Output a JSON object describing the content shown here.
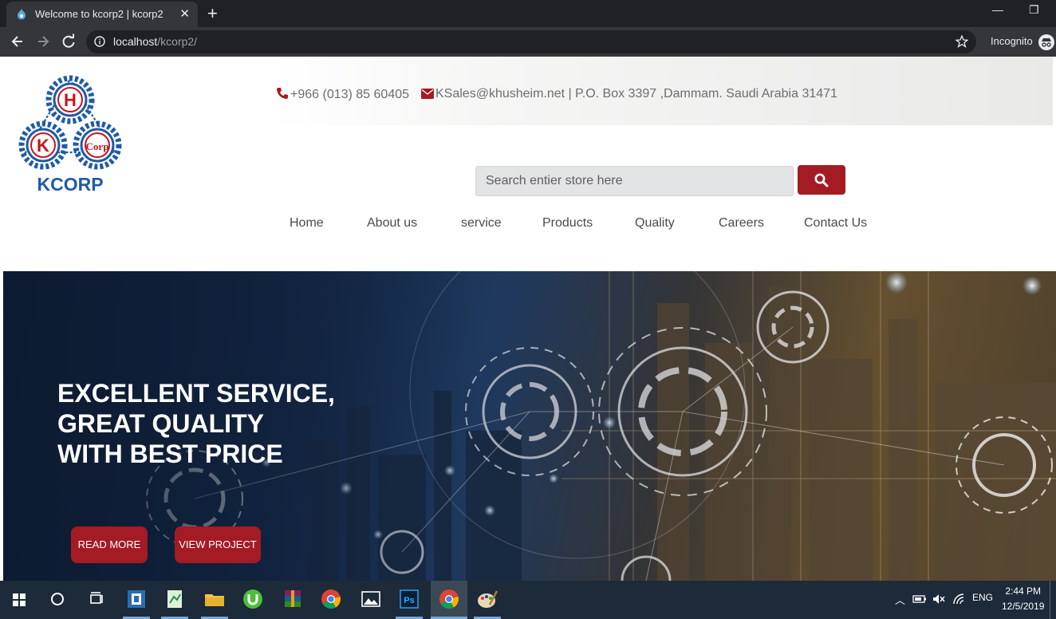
{
  "browser": {
    "tab_title": "Welcome to kcorp2 | kcorp2",
    "url_host": "localhost",
    "url_path": "/kcorp2/",
    "incognito_label": "Incognito"
  },
  "contact": {
    "phone": "+966 (013) 85 60405",
    "email_address": "KSales@khusheim.net | P.O. Box 3397 ,Dammam. Saudi Arabia 31471"
  },
  "logo": {
    "text": "KCORP",
    "letters": [
      "H",
      "K",
      "Corp"
    ]
  },
  "search": {
    "placeholder": "Search entier store here"
  },
  "nav": {
    "items": [
      "Home",
      "About us",
      "service",
      "Products",
      "Quality",
      "Careers",
      "Contact Us"
    ]
  },
  "hero": {
    "line1": "EXCELLENT SERVICE,",
    "line2": "GREAT QUALITY",
    "line3": "WITH BEST PRICE",
    "btn_read_more": "READ MORE",
    "btn_view_project": "VIEW PROJECT"
  },
  "taskbar": {
    "lang": "ENG",
    "time": "2:44 PM",
    "date": "12/5/2019"
  },
  "colors": {
    "brand_red": "#a41b24",
    "logo_blue": "#1f5aa6"
  }
}
